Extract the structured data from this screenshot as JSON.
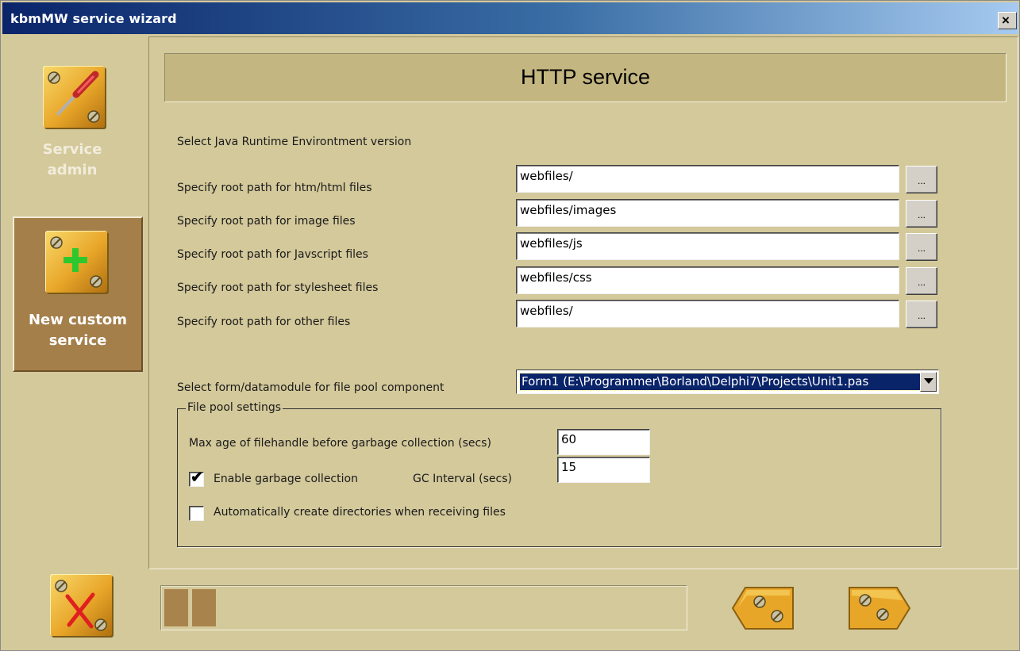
{
  "window": {
    "title": "kbmMW service wizard",
    "close_symbol": "×"
  },
  "sidebar": {
    "items": [
      {
        "label": "Service admin",
        "icon": "screwdriver-icon"
      },
      {
        "label": "New custom service",
        "icon": "plus-icon"
      }
    ],
    "cancel_icon": "cancel-x-icon"
  },
  "header": {
    "title": "HTTP service"
  },
  "form": {
    "jre_label": "Select Java Runtime Environtment version",
    "paths": [
      {
        "label": "Specify root path for htm/html files",
        "value": "webfiles/"
      },
      {
        "label": "Specify root path for image files",
        "value": "webfiles/images"
      },
      {
        "label": "Specify root path for Javscript files",
        "value": "webfiles/js"
      },
      {
        "label": "Specify root path for stylesheet files",
        "value": "webfiles/css"
      },
      {
        "label": "Specify root path for other files",
        "value": "webfiles/"
      }
    ],
    "browse_label": "...",
    "module_label": "Select form/datamodule for file pool component",
    "module_value": "Form1 (E:\\Programmer\\Borland\\Delphi7\\Projects\\Unit1.pas"
  },
  "file_pool": {
    "title": "File pool settings",
    "max_age_label": "Max age of filehandle before garbage collection (secs)",
    "max_age_value": "60",
    "gc_enable_label": "Enable garbage collection",
    "gc_enabled": true,
    "gc_interval_label": "GC Interval (secs)",
    "gc_interval_value": "15",
    "auto_create_label": "Automatically create directories when receiving files",
    "auto_create": false
  },
  "progress": {
    "steps_completed": 2
  },
  "navigation": {
    "back_icon": "back-arrow-icon",
    "next_icon": "next-arrow-icon"
  },
  "colors": {
    "accent": "#e8a629",
    "panel": "#d4c99b",
    "header": "#c4b680",
    "selection": "#0a246a",
    "progress_fill": "#a8844c"
  }
}
